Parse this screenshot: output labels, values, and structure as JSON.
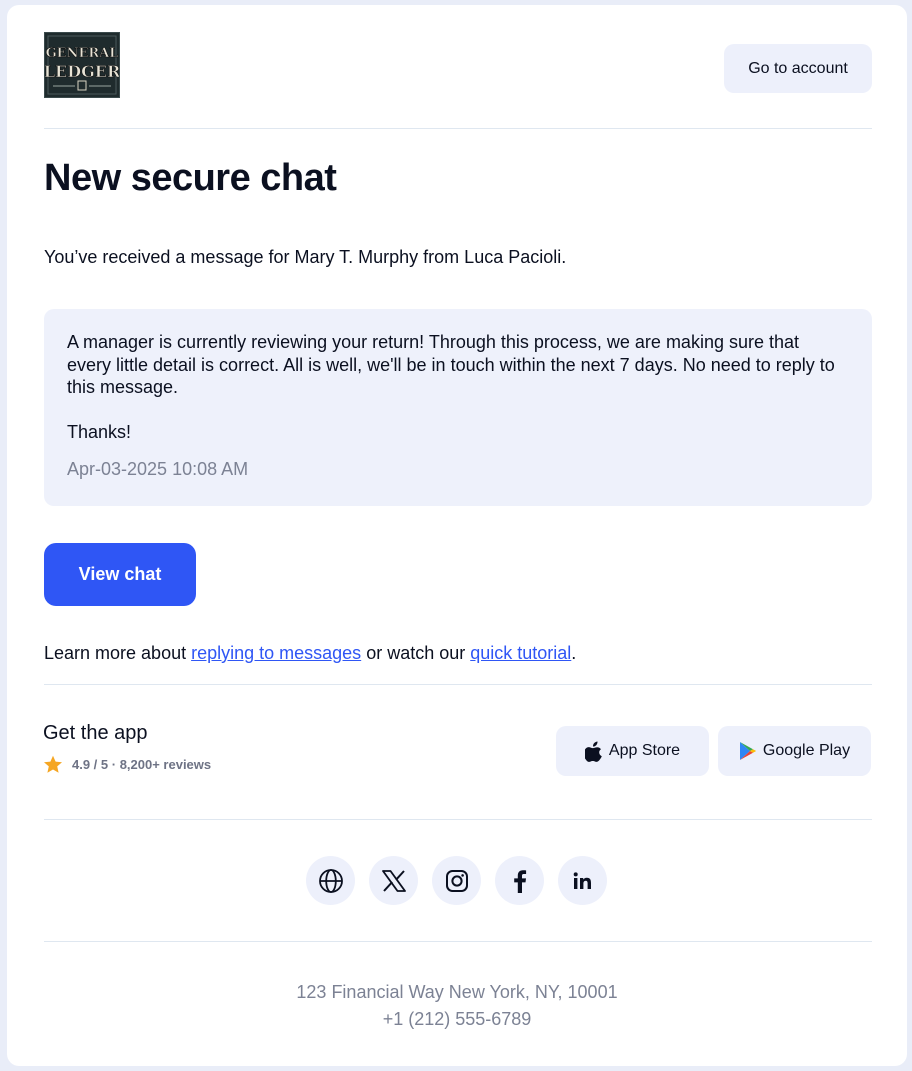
{
  "header": {
    "logo": {
      "line1": "GENERAL",
      "line2": "LEDGER",
      "alt": "General Ledger logo"
    },
    "go_to_account_label": "Go to account"
  },
  "main": {
    "title": "New secure chat",
    "intro": "You’ve received a message for Mary T. Murphy from Luca Pacioli.",
    "message": {
      "body": "A manager is currently reviewing your return! Through this process, we are making sure that every little detail is correct. All is well, we'll be in touch within the next 7 days. No need to reply to this message.",
      "thanks": "Thanks!",
      "timestamp": "Apr-03-2025 10:08 AM"
    },
    "view_chat_label": "View chat",
    "learn_more": {
      "prefix": "Learn more about ",
      "link1": "replying to messages",
      "middle": " or watch our ",
      "link2": "quick tutorial",
      "suffix": "."
    }
  },
  "app": {
    "title": "Get the app",
    "rating_text": "4.9 / 5 · 8,200+ reviews",
    "star_color": "#f5a623",
    "app_store_label": "App Store",
    "google_play_label": "Google Play"
  },
  "socials": [
    {
      "name": "globe-icon"
    },
    {
      "name": "x-icon"
    },
    {
      "name": "instagram-icon"
    },
    {
      "name": "facebook-icon"
    },
    {
      "name": "linkedin-icon"
    }
  ],
  "footer": {
    "address_line": "123 Financial Way New York, NY, 10001",
    "phone": "+1 (212) 555-6789"
  },
  "colors": {
    "accent": "#2f56f5",
    "panel": "#eef1fb",
    "muted_text": "#7c8294"
  }
}
